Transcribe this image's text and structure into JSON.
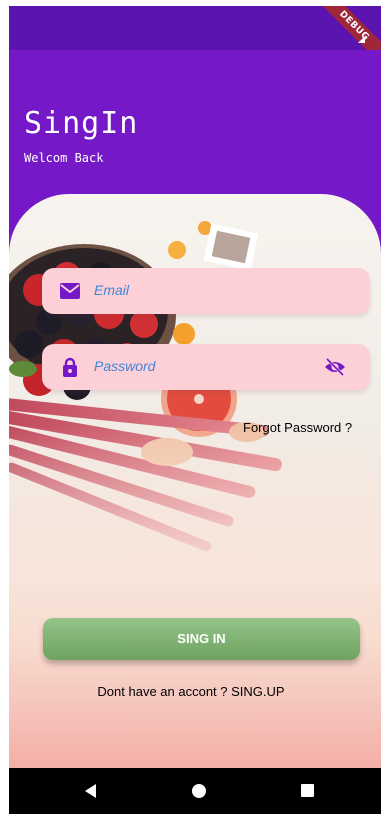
{
  "status_bar": {
    "debug_label": "DEBUG"
  },
  "header": {
    "title": "SingIn",
    "subtitle": "Welcom Back"
  },
  "form": {
    "email_placeholder": "Email",
    "password_placeholder": "Password",
    "forgot_password": "Forgot Password ?",
    "signin_label": "SING IN",
    "signup_text": "Dont have an accont ? SING.UP"
  },
  "icons": {
    "email": "mail-icon",
    "password": "lock-icon",
    "visibility": "eye-off-icon",
    "nav_back": "back-triangle-icon",
    "nav_home": "home-circle-icon",
    "nav_recent": "recent-square-icon"
  },
  "colors": {
    "header": "#7418c8",
    "status_bar": "#5b14b0",
    "field_bg": "#fdd0d8",
    "icon": "#7418c8",
    "placeholder": "#3f86d8",
    "button": "#7fb06f"
  }
}
